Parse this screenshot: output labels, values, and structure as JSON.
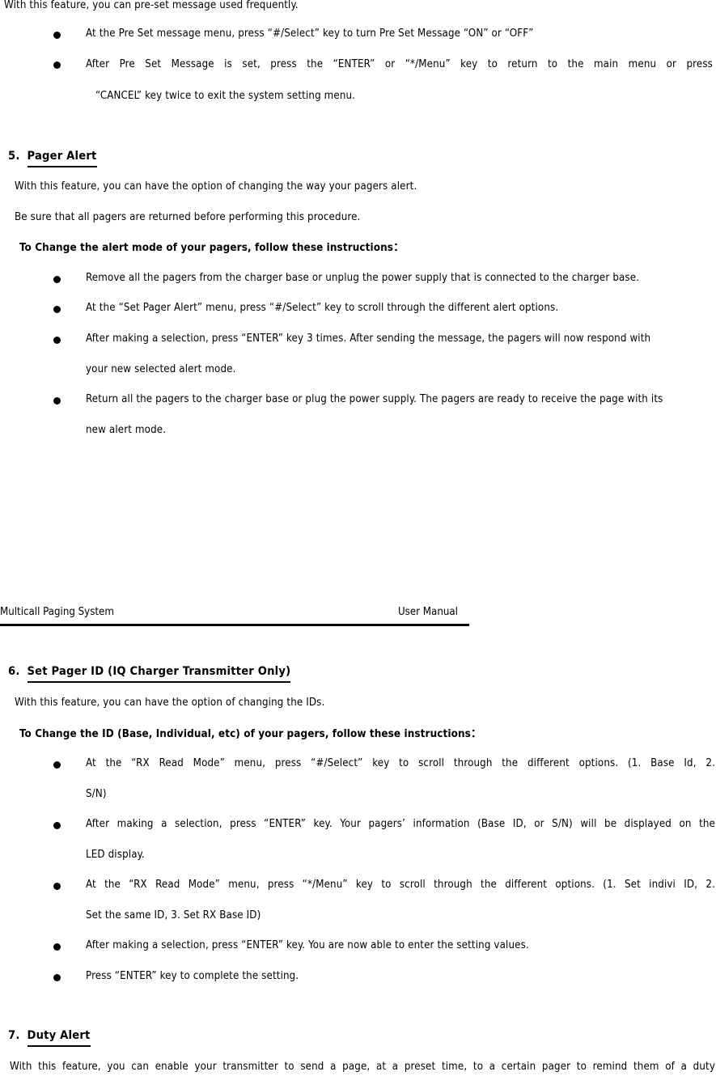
{
  "document": {
    "footer": {
      "left_text": "Multicall Paging System",
      "right_text": "User  Manual"
    }
  },
  "top_block": {
    "intro": "With this feature, you can pre-set message used frequently.",
    "bullets": [
      {
        "line1": "At the Pre Set message menu, press  “#/Select”  key to turn Pre Set Message  “ON”  or  “OFF”"
      },
      {
        "line1": "After Pre Set Message is set, press the  “ENTER”  or  “*/Menu”  key to return to the main menu or press",
        "line2": "“CANCEL”  key twice to exit the system setting menu."
      }
    ]
  },
  "section5": {
    "number": "5.",
    "title": "Pager Alert",
    "intro1": "With this feature, you can have the option of changing the way your pagers alert.",
    "intro2": "Be sure that all pagers are returned before performing this procedure.",
    "subhead": "To Change the alert mode of your pagers, follow these instructions：",
    "bullets": [
      {
        "line1": "Remove all the pagers from the charger base or unplug the power supply that is connected to the charger base."
      },
      {
        "line1": "At the  “Set Pager Alert”  menu, press  “#/Select”  key to scroll through the different alert options."
      },
      {
        "line1": "After making a selection, press  “ENTER”  key 3 times. After sending the message, the pagers will now respond with",
        "line2": "your new selected alert mode."
      },
      {
        "line1": "Return all the pagers to the charger base or plug the power supply. The pagers are ready to receive the page with its",
        "line2": "new alert mode."
      }
    ]
  },
  "section6": {
    "number": "6.",
    "title": "Set Pager ID (IQ Charger Transmitter Only)",
    "intro1": "With this feature, you can have the option of changing the IDs.",
    "subhead": "To Change the ID (Base, Individual, etc) of your pagers, follow these instructions：",
    "bullets": [
      {
        "line1": "At the  “RX Read Mode”  menu, press  “#/Select”  key to scroll through the different options. (1. Base Id, 2.",
        "line2": "S/N)"
      },
      {
        "line1": "After making a selection, press  “ENTER”  key. Your pagers’  information (Base ID, or S/N) will be displayed on the",
        "line2": "LED display."
      },
      {
        "line1": "At the  “RX Read Mode”  menu, press  “*/Menu”  key to scroll through the different options. (1. Set indivi ID, 2.",
        "line2": "Set the same ID, 3. Set RX Base ID)"
      },
      {
        "line1": "After making a selection, press  “ENTER”  key. You are now able to enter the setting values."
      },
      {
        "line1": "Press  “ENTER”  key to complete the setting."
      }
    ]
  },
  "section7": {
    "number": "7.",
    "title": "Duty Alert",
    "intro1": "With this feature, you can enable your transmitter to send a page, at a preset time, to a certain pager to remind them of a duty"
  }
}
